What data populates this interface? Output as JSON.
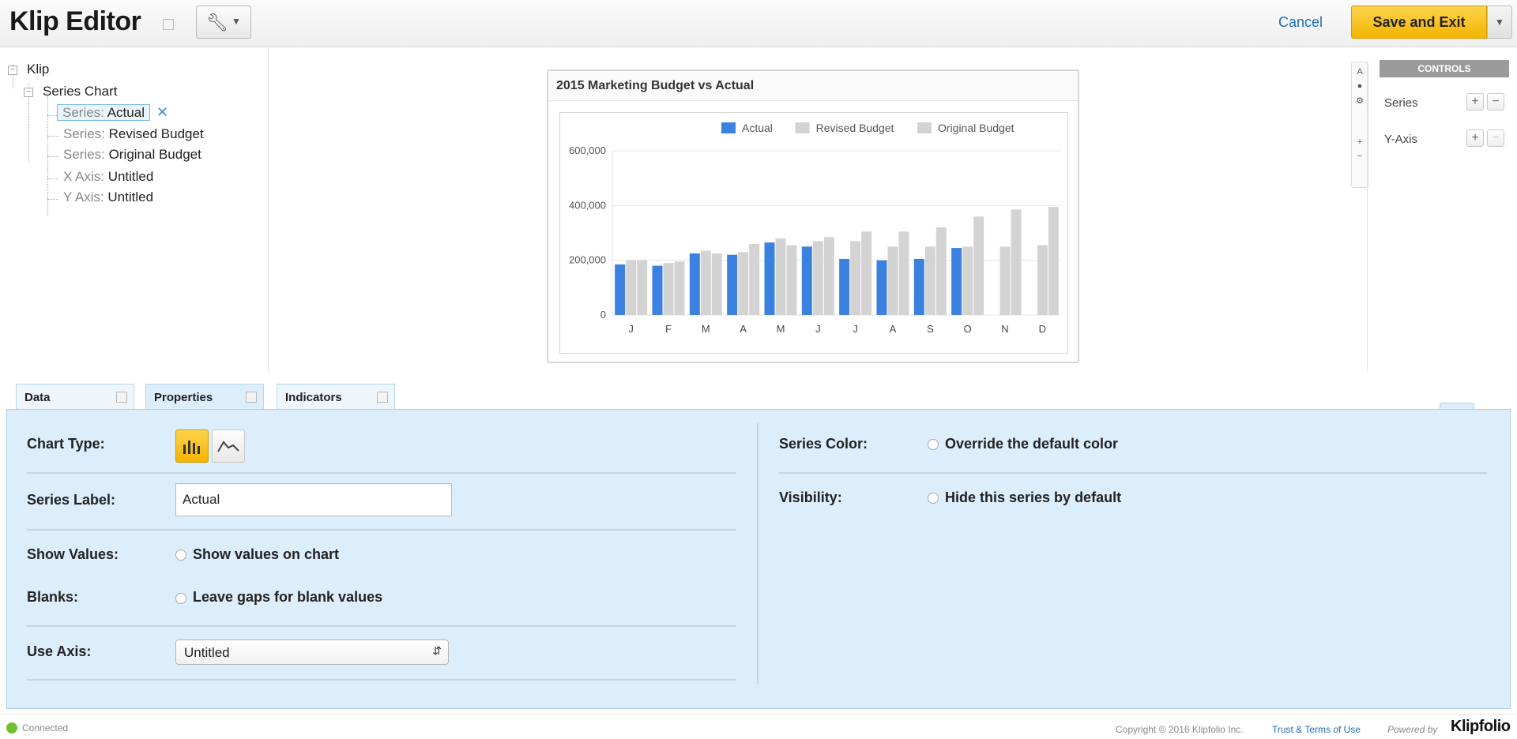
{
  "header": {
    "title": "Klip Editor",
    "cancel_label": "Cancel",
    "save_label": "Save and Exit"
  },
  "tree": {
    "root": "Klip",
    "chart": "Series Chart",
    "items": [
      {
        "prefix": "Series:",
        "name": "Actual"
      },
      {
        "prefix": "Series:",
        "name": "Revised Budget"
      },
      {
        "prefix": "Series:",
        "name": "Original Budget"
      },
      {
        "prefix": "X Axis:",
        "name": "Untitled"
      },
      {
        "prefix": "Y Axis:",
        "name": "Untitled"
      }
    ]
  },
  "controls": {
    "header": "CONTROLS",
    "rows": [
      {
        "label": "Series",
        "remove_enabled": true
      },
      {
        "label": "Y-Axis",
        "remove_enabled": false
      }
    ]
  },
  "tabs": [
    {
      "label": "Data"
    },
    {
      "label": "Properties"
    },
    {
      "label": "Indicators"
    }
  ],
  "properties": {
    "chart_type_label": "Chart Type:",
    "chart_type_selected": "bar",
    "series_label_label": "Series Label:",
    "series_label_value": "Actual",
    "show_values_label": "Show Values:",
    "show_values_text": "Show values on chart",
    "blanks_label": "Blanks:",
    "blanks_text": "Leave gaps for blank values",
    "use_axis_label": "Use Axis:",
    "use_axis_value": "Untitled",
    "series_color_label": "Series Color:",
    "series_color_text": "Override the default color",
    "visibility_label": "Visibility:",
    "visibility_text": "Hide this series by default"
  },
  "footer": {
    "status": "Connected",
    "copyright": "Copyright © 2016 Klipfolio Inc.",
    "terms": "Trust & Terms of Use",
    "powered_by": "Powered by",
    "brand": "Klipfolio"
  },
  "colors": {
    "actual": "#3b82e0",
    "budget": "#d3d3d3",
    "accent": "#f4b400",
    "panel_bg": "#dcedfb"
  },
  "chart_data": {
    "type": "bar",
    "title": "2015 Marketing Budget vs Actual",
    "categories": [
      "J",
      "F",
      "M",
      "A",
      "M",
      "J",
      "J",
      "A",
      "S",
      "O",
      "N",
      "D"
    ],
    "series": [
      {
        "name": "Actual",
        "values": [
          185000,
          180000,
          225000,
          220000,
          265000,
          250000,
          205000,
          200000,
          205000,
          245000,
          null,
          null
        ]
      },
      {
        "name": "Revised Budget",
        "values": [
          200000,
          190000,
          235000,
          230000,
          280000,
          270000,
          270000,
          250000,
          250000,
          250000,
          250000,
          255000
        ]
      },
      {
        "name": "Original Budget",
        "values": [
          200000,
          195000,
          225000,
          260000,
          255000,
          285000,
          305000,
          305000,
          320000,
          360000,
          385000,
          395000
        ]
      }
    ],
    "ylim": [
      0,
      600000
    ],
    "yticks": [
      "0",
      "200,000",
      "400,000",
      "600,000"
    ],
    "legend": "top-right",
    "grid": true
  }
}
